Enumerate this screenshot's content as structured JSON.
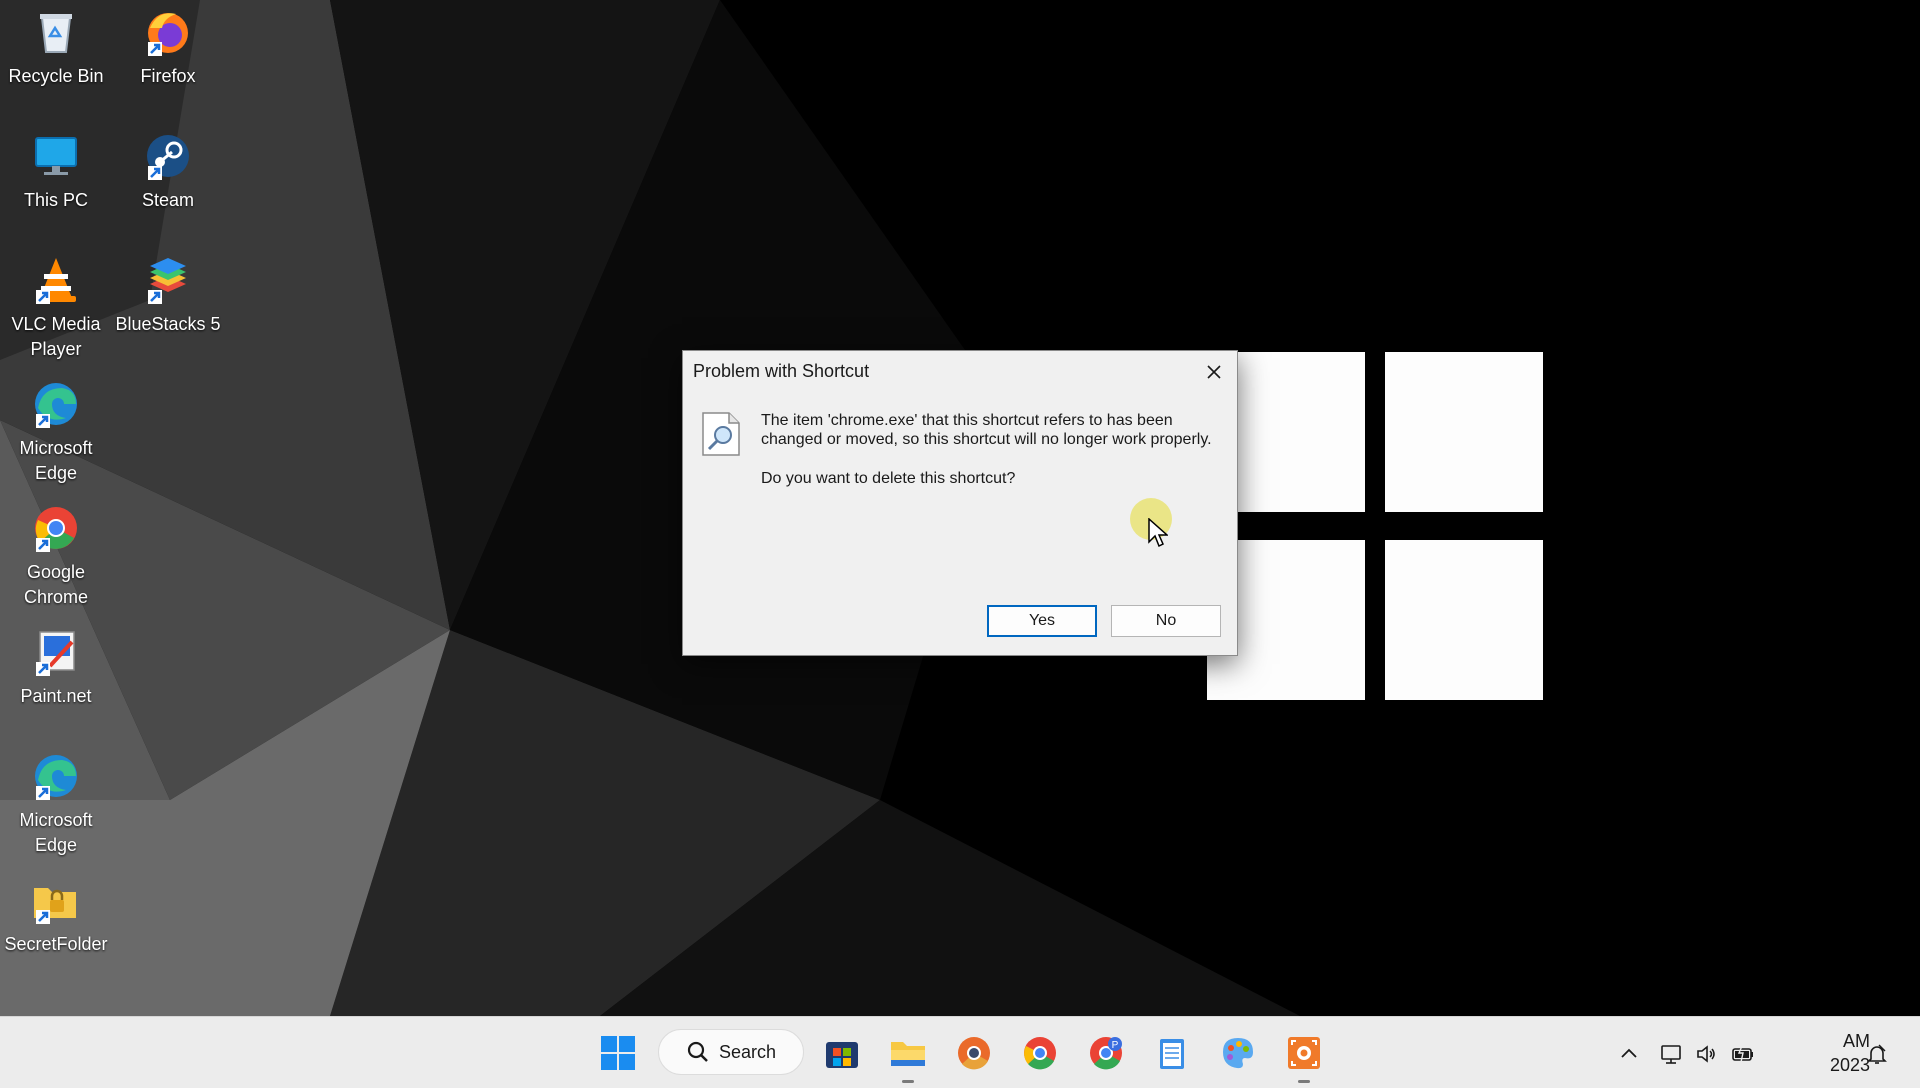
{
  "desktop": {
    "icons": [
      {
        "label": "Recycle Bin",
        "icon": "recycle-bin-icon"
      },
      {
        "label": "Firefox",
        "icon": "firefox-icon"
      },
      {
        "label": "This PC",
        "icon": "this-pc-icon"
      },
      {
        "label": "Steam",
        "icon": "steam-icon"
      },
      {
        "label": "VLC Media Player",
        "icon": "vlc-icon"
      },
      {
        "label": "BlueStacks 5",
        "icon": "bluestacks-icon"
      },
      {
        "label": "Microsoft Edge",
        "icon": "edge-icon"
      },
      {
        "label": "Google Chrome",
        "icon": "chrome-icon"
      },
      {
        "label": "Paint.net",
        "icon": "paintnet-icon"
      },
      {
        "label": "Microsoft Edge",
        "icon": "edge-icon"
      },
      {
        "label": "SecretFolder",
        "icon": "secretfolder-icon"
      }
    ]
  },
  "dialog": {
    "title": "Problem with Shortcut",
    "message": "The item 'chrome.exe' that this shortcut refers to has been changed or moved, so this shortcut will no longer work properly.",
    "question": "Do you want to delete this shortcut?",
    "yes_label": "Yes",
    "no_label": "No",
    "icon": "file-search-icon"
  },
  "taskbar": {
    "search_label": "Search",
    "pinned": [
      "start-icon",
      "microsoft-store-icon",
      "file-explorer-icon",
      "chrome-canary-icon",
      "chrome-icon",
      "chrome-profile-icon",
      "notepad-icon",
      "paint-icon",
      "recorder-icon"
    ],
    "tray": [
      "chevron-up-icon",
      "network-icon",
      "volume-icon",
      "battery-icon"
    ],
    "clock_time": "AM",
    "clock_year": "2023",
    "notification_icon": "notification-bell-icon"
  },
  "colors": {
    "accent": "#0067c0",
    "dialog_bg": "#f0f0f0",
    "taskbar_bg": "#ececec"
  }
}
